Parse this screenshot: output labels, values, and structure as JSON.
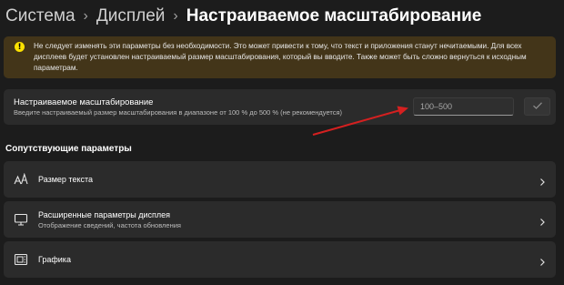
{
  "breadcrumb": {
    "items": [
      "Система",
      "Дисплей"
    ],
    "current": "Настраиваемое масштабирование",
    "separator": "›"
  },
  "warning": {
    "icon": "warning-icon",
    "text": "Не следует изменять эти параметры без необходимости. Это может привести к тому, что текст и приложения станут нечитаемыми. Для всех дисплеев будет установлен настраиваемый размер масштабирования, который вы вводите. Также может быть сложно вернуться к исходным параметрам."
  },
  "custom_scaling": {
    "title": "Настраиваемое масштабирование",
    "description": "Введите настраиваемый размер масштабирования в диапазоне от 100 % до 500 % (не рекомендуется)",
    "input_placeholder": "100–500",
    "input_value": "",
    "confirm_icon": "checkmark-icon"
  },
  "related": {
    "heading": "Сопутствующие параметры",
    "items": [
      {
        "label": "Размер текста",
        "sublabel": "",
        "icon": "text-size-icon"
      },
      {
        "label": "Расширенные параметры дисплея",
        "sublabel": "Отображение сведений, частота обновления",
        "icon": "monitor-icon"
      },
      {
        "label": "Графика",
        "sublabel": "",
        "icon": "graphics-icon"
      }
    ]
  },
  "colors": {
    "background": "#1c1c1c",
    "card": "#2b2b2b",
    "warning_bg": "#433519",
    "warning_icon": "#fce100",
    "annotation_arrow": "#d42020"
  }
}
